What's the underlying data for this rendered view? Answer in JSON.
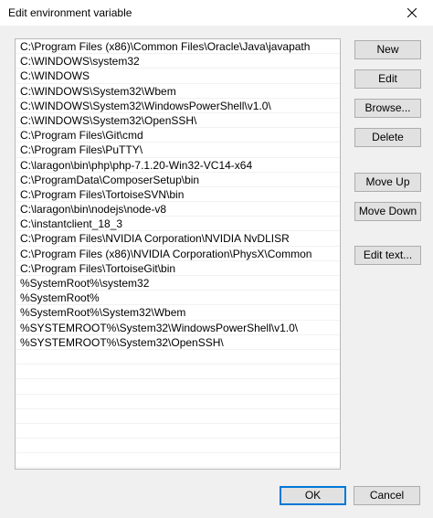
{
  "window": {
    "title": "Edit environment variable",
    "close_icon": "close-icon"
  },
  "paths": [
    "C:\\Program Files (x86)\\Common Files\\Oracle\\Java\\javapath",
    "C:\\WINDOWS\\system32",
    "C:\\WINDOWS",
    "C:\\WINDOWS\\System32\\Wbem",
    "C:\\WINDOWS\\System32\\WindowsPowerShell\\v1.0\\",
    "C:\\WINDOWS\\System32\\OpenSSH\\",
    "C:\\Program Files\\Git\\cmd",
    "C:\\Program Files\\PuTTY\\",
    "C:\\laragon\\bin\\php\\php-7.1.20-Win32-VC14-x64",
    "C:\\ProgramData\\ComposerSetup\\bin",
    "C:\\Program Files\\TortoiseSVN\\bin",
    "C:\\laragon\\bin\\nodejs\\node-v8",
    "C:\\instantclient_18_3",
    "C:\\Program Files\\NVIDIA Corporation\\NVIDIA NvDLISR",
    "C:\\Program Files (x86)\\NVIDIA Corporation\\PhysX\\Common",
    "C:\\Program Files\\TortoiseGit\\bin",
    "%SystemRoot%\\system32",
    "%SystemRoot%",
    "%SystemRoot%\\System32\\Wbem",
    "%SYSTEMROOT%\\System32\\WindowsPowerShell\\v1.0\\",
    "%SYSTEMROOT%\\System32\\OpenSSH\\",
    "",
    "",
    "",
    "",
    "",
    "",
    "",
    ""
  ],
  "buttons": {
    "new": "New",
    "edit": "Edit",
    "browse": "Browse...",
    "delete": "Delete",
    "move_up": "Move Up",
    "move_down": "Move Down",
    "edit_text": "Edit text...",
    "ok": "OK",
    "cancel": "Cancel"
  },
  "colors": {
    "window_bg": "#f0f0f0",
    "button_bg": "#e1e1e1",
    "button_border": "#adadad",
    "default_button_border": "#0078d7",
    "list_border": "#b9b9b9"
  }
}
